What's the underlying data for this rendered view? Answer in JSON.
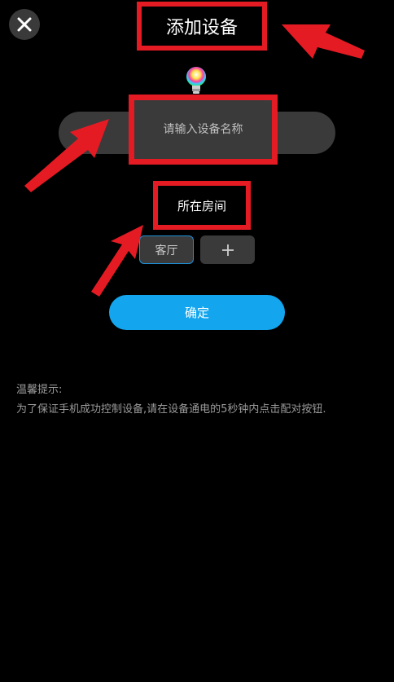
{
  "header": {
    "title": "添加设备",
    "close_icon": "close-icon"
  },
  "device": {
    "icon": "rgb-bulb-icon",
    "name_placeholder": "请输入设备名称"
  },
  "room": {
    "label": "所在房间",
    "options": [
      "客厅"
    ],
    "selected": "客厅",
    "add_icon": "plus-icon"
  },
  "actions": {
    "confirm_label": "确定"
  },
  "tips": {
    "title": "温馨提示:",
    "body": "为了保证手机成功控制设备,请在设备通电的5秒钟内点击配对按钮."
  },
  "colors": {
    "background": "#000000",
    "annotation_red": "#e51b24",
    "accent_blue": "#13a6ee",
    "control_gray": "#3a3a3a"
  }
}
